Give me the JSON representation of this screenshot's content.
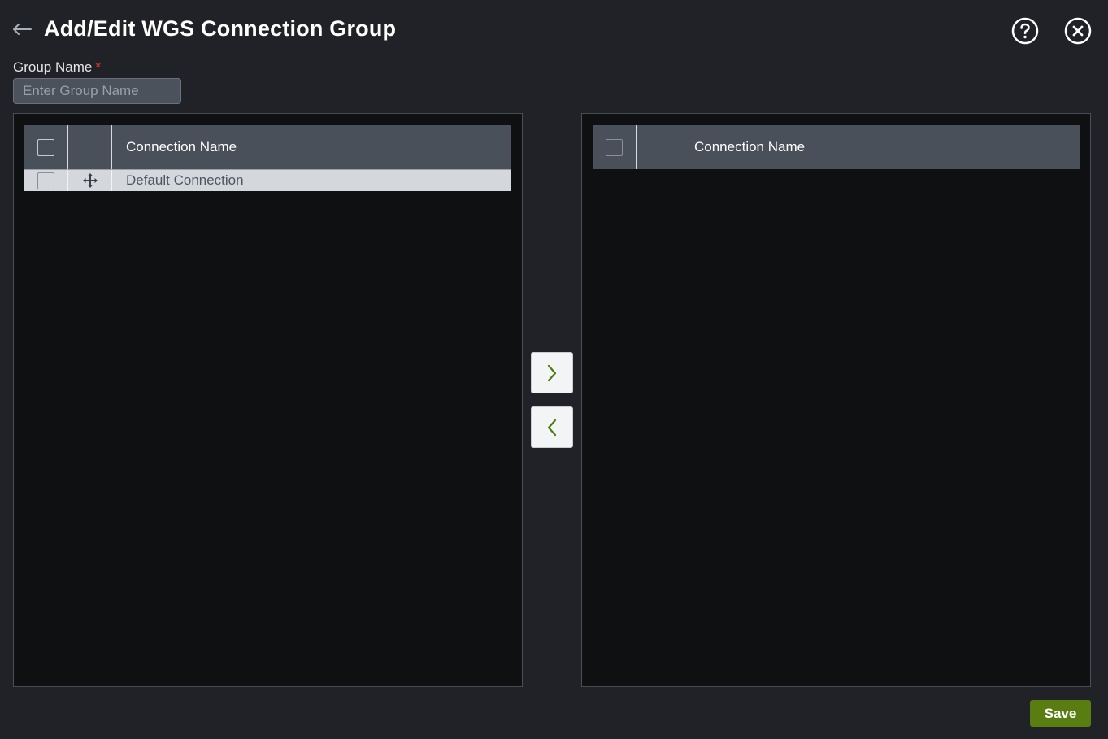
{
  "header": {
    "title": "Add/Edit WGS Connection Group",
    "back_icon": "arrow-left-icon",
    "help_icon": "help-circle-icon",
    "close_icon": "close-circle-icon"
  },
  "group_name": {
    "label": "Group Name",
    "required_marker": "*",
    "value": "",
    "placeholder": "Enter Group Name"
  },
  "available": {
    "column_header": "Connection Name",
    "rows": [
      {
        "name": "Default Connection",
        "checked": false
      }
    ]
  },
  "selected": {
    "column_header": "Connection Name",
    "rows": []
  },
  "transfer": {
    "move_right_icon": "chevron-right-icon",
    "move_left_icon": "chevron-left-icon"
  },
  "footer": {
    "save_label": "Save"
  },
  "colors": {
    "background": "#212227",
    "panel": "#0f1012",
    "table_header": "#4a505a",
    "row_selected": "#d4d7dc",
    "accent": "#5a7d12",
    "required": "#e53935"
  }
}
